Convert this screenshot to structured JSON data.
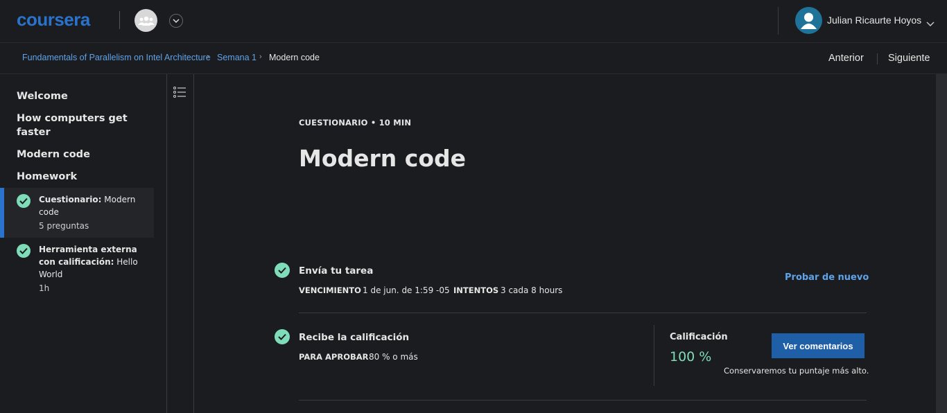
{
  "header": {
    "logo_text": "coursera",
    "user_name": "Julian Ricaurte Hoyos",
    "icons": {
      "group": "group-avatar-icon",
      "user": "user-avatar-icon",
      "chevron": "chevron-down-icon"
    }
  },
  "breadcrumb": {
    "items": [
      "Fundamentals of Parallelism on Intel Architecture",
      "Semana 1",
      "Modern code"
    ],
    "previous_label": "Anterior",
    "next_label": "Siguiente"
  },
  "sidebar": {
    "headings": [
      "Welcome",
      "How computers get faster",
      "Modern code",
      "Homework"
    ],
    "items": [
      {
        "type_label": "Cuestionario:",
        "title": "Modern code",
        "meta": "5 preguntas",
        "completed": true,
        "active": true
      },
      {
        "type_label": "Herramienta externa con calificación:",
        "title": "Hello World",
        "meta": "1h",
        "completed": true,
        "active": false
      }
    ]
  },
  "main": {
    "eyebrow": "CUESTIONARIO • 10 MIN",
    "title": "Modern code",
    "submit": {
      "title": "Envía tu tarea",
      "due_key": "VENCIMIENTO",
      "due_value": "1 de jun. de 1:59 -05",
      "attempts_key": "INTENTOS",
      "attempts_value": "3 cada 8 hours",
      "retry_label": "Probar de nuevo"
    },
    "grade": {
      "title": "Recibe la calificación",
      "pass_key": "PARA APROBAR",
      "pass_value": "80 % o más",
      "grade_label": "Calificación",
      "grade_value": "100 %",
      "feedback_button": "Ver comentarios",
      "note": "Conservaremos tu puntaje más alto."
    }
  },
  "colors": {
    "brand": "#2a73cc",
    "success": "#7fdcb8",
    "link": "#5fa3e8",
    "button": "#1f5fa8"
  }
}
